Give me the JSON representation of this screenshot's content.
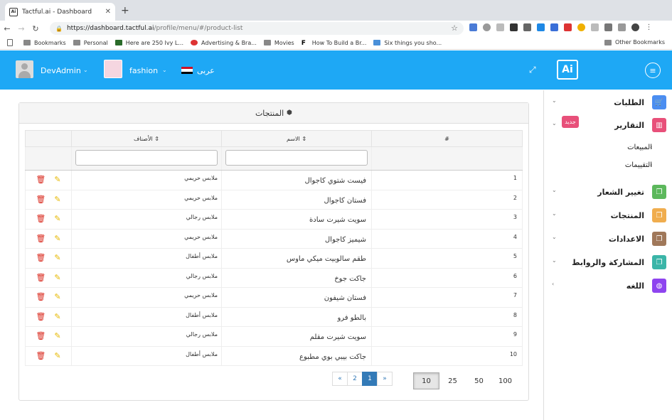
{
  "browser": {
    "tab_title": "Tactful.ai - Dashboard",
    "url_host": "https://dashboard.tactful.ai",
    "url_path": "/profile/menu/#/product-list",
    "bookmarks": [
      "Bookmarks",
      "Personal",
      "Here are 250 Ivy L...",
      "Advertising & Bra...",
      "Movies",
      "How To Build a Br...",
      "Six things you sho..."
    ],
    "other_bookmarks": "Other Bookmarks"
  },
  "header": {
    "user": "DevAdmin",
    "store": "fashion",
    "language": "عربى",
    "logo": "Ai"
  },
  "panel": {
    "title": "المنتجات"
  },
  "table": {
    "headers": {
      "num": "#",
      "name": "الاسم",
      "category": "الأصناف"
    },
    "rows": [
      {
        "num": "1",
        "name": "فيست شتوي كاجوال",
        "category": "ملابس حريمي"
      },
      {
        "num": "2",
        "name": "فستان كاجوال",
        "category": "ملابس حريمي"
      },
      {
        "num": "3",
        "name": "سويت شيرت سادة",
        "category": "ملابس رجالي"
      },
      {
        "num": "4",
        "name": "شيميز كاجوال",
        "category": "ملابس حريمي"
      },
      {
        "num": "5",
        "name": "طقم سالوبيت ميكي ماوس",
        "category": "ملابس أطفال"
      },
      {
        "num": "6",
        "name": "جاكت جوخ",
        "category": "ملابس رجالي"
      },
      {
        "num": "7",
        "name": "فستان شيفون",
        "category": "ملابس حريمي"
      },
      {
        "num": "8",
        "name": "بالطو فرو",
        "category": "ملابس أطفال"
      },
      {
        "num": "9",
        "name": "سويت شيرت مقلم",
        "category": "ملابس رجالي"
      },
      {
        "num": "10",
        "name": "جاكت بيبي بوي مطبوع",
        "category": "ملابس أطفال"
      }
    ]
  },
  "pagination": {
    "first": "«",
    "pages": [
      "2",
      "1"
    ],
    "last": "»",
    "active_page": "1"
  },
  "page_sizes": [
    "10",
    "25",
    "50",
    "100"
  ],
  "sidebar": {
    "items": [
      {
        "label": "الطلبات",
        "color": "#4b8ef1",
        "icon": "cart-icon"
      },
      {
        "label": "التقارير",
        "color": "#e8507a",
        "icon": "chart-icon"
      },
      {
        "label": "تغيير الشعار",
        "color": "#5cb85c",
        "icon": "copy-icon"
      },
      {
        "label": "المنتجات",
        "color": "#f0ad4e",
        "icon": "copy-icon"
      },
      {
        "label": "الاعدادات",
        "color": "#a0785a",
        "icon": "copy-icon"
      },
      {
        "label": "المشاركة والروابط",
        "color": "#3bb5a8",
        "icon": "copy-icon"
      },
      {
        "label": "اللغه",
        "color": "#8e44ef",
        "icon": "globe-icon"
      }
    ],
    "badge": "جديد",
    "sub_items": [
      "المبيعات",
      "التقييمات"
    ]
  }
}
